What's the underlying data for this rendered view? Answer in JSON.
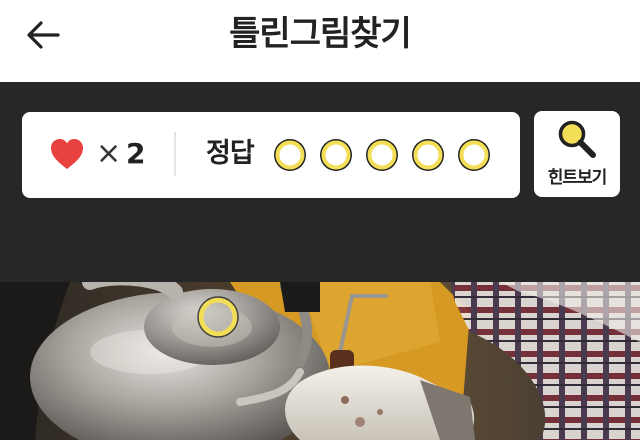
{
  "header": {
    "title": "틀린그림찾기",
    "back_icon": "arrow-left-icon"
  },
  "status": {
    "lives_icon": "heart-icon",
    "lives_color": "#e94040",
    "times_symbol": "×",
    "lives_count": "2",
    "answer_label": "정답",
    "answers_total": 5,
    "answers_found": 0,
    "slot_color": "#f2de57"
  },
  "hint": {
    "label": "힌트보기",
    "icon": "magnifier-icon"
  },
  "puzzle": {
    "found_marker_color": "#f2de57",
    "found_markers": 1
  }
}
